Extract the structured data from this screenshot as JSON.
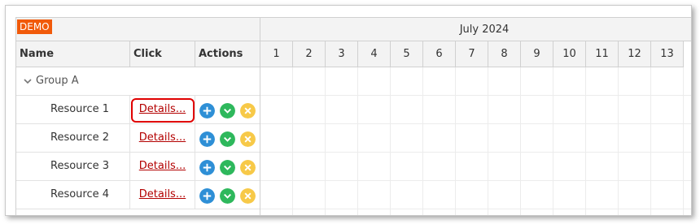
{
  "demo_badge": "DEMO",
  "columns": {
    "name": "Name",
    "click": "Click",
    "actions": "Actions"
  },
  "group": {
    "label": "Group A",
    "icon": "chevron-down-icon"
  },
  "resources": [
    {
      "name": "Resource 1",
      "link": "Details..."
    },
    {
      "name": "Resource 2",
      "link": "Details..."
    },
    {
      "name": "Resource 3",
      "link": "Details..."
    },
    {
      "name": "Resource 4",
      "link": "Details..."
    }
  ],
  "actions": [
    {
      "icon": "plus-icon",
      "color": "#2e8fd6"
    },
    {
      "icon": "check-icon",
      "color": "#2eb85c"
    },
    {
      "icon": "close-icon",
      "color": "#f7c948"
    }
  ],
  "timeline": {
    "month": "July 2024",
    "days": [
      "1",
      "2",
      "3",
      "4",
      "5",
      "6",
      "7",
      "8",
      "9",
      "10",
      "11",
      "12",
      "13"
    ]
  },
  "colors": {
    "highlight": "#e00000",
    "link": "#b30000",
    "demo": "#f15a0a"
  }
}
